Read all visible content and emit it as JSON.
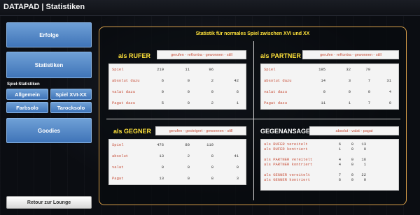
{
  "window": {
    "title": "DATAPAD | Statistiken"
  },
  "nav": {
    "erfolge": "Erfolge",
    "statistiken": "Statistiken",
    "section_label": "Spiel-Statistiken",
    "allgemein": "Allgemein",
    "spiel_xvi_xx": "Spiel XVI-XX",
    "farbsolo": "Farbsolo",
    "tarocksolo": "Tarocksolo",
    "goodies": "Goodies",
    "retour": "Retour zur Lounge"
  },
  "panel": {
    "title": "Statistik für normales Spiel zwischen XVI und XX",
    "rufer": {
      "heading": "als RUFER",
      "columns": "gerufen - reKontra - gewonnen - still",
      "rows": [
        {
          "label": "Spiel",
          "values": [
            "219",
            "11",
            "96",
            ""
          ]
        },
        {
          "label": "absolut dazu",
          "values": [
            "6",
            "0",
            "2",
            "42"
          ]
        },
        {
          "label": "valat dazu",
          "values": [
            "0",
            "0",
            "0",
            "6"
          ]
        },
        {
          "label": "Pagat dazu",
          "values": [
            "5",
            "0",
            "2",
            "1"
          ]
        }
      ]
    },
    "partner": {
      "heading": "als PARTNER",
      "columns": "gerufen - reKontra - gewonnen - still",
      "rows": [
        {
          "label": "Spiel",
          "values": [
            "195",
            "32",
            "79",
            ""
          ]
        },
        {
          "label": "absolut dazu",
          "values": [
            "14",
            "3",
            "7",
            "31"
          ]
        },
        {
          "label": "valat dazu",
          "values": [
            "0",
            "0",
            "0",
            "4"
          ]
        },
        {
          "label": "Pagat dazu",
          "values": [
            "11",
            "1",
            "7",
            "0"
          ]
        }
      ]
    },
    "gegner": {
      "heading": "als GEGNER",
      "columns": "gerufen - gesteigert - gewonnen - still",
      "rows": [
        {
          "label": "Spiel",
          "values": [
            "476",
            "80",
            "119",
            ""
          ]
        },
        {
          "label": "absolut",
          "values": [
            "13",
            "2",
            "8",
            "41"
          ]
        },
        {
          "label": "valat",
          "values": [
            "0",
            "0",
            "0",
            "0"
          ]
        },
        {
          "label": "Pagat",
          "values": [
            "13",
            "0",
            "8",
            "3"
          ]
        }
      ]
    },
    "ansagen": {
      "heading": "GEGENANSAGEN",
      "columns": "absolut - valat - pagat",
      "groups": [
        {
          "lines": [
            "als RUFER vereitelt",
            "als RUFER kontriert"
          ],
          "values": [
            [
              "6",
              "0",
              "13"
            ],
            [
              "1",
              "0",
              "0"
            ]
          ]
        },
        {
          "lines": [
            "als PARTNER vereitelt",
            "als PARTNER kontriert"
          ],
          "values": [
            [
              "4",
              "0",
              "16"
            ],
            [
              "4",
              "0",
              "1"
            ]
          ]
        },
        {
          "lines": [
            "als GEGNER vereitelt",
            "als GEGNER kontriert"
          ],
          "values": [
            [
              "7",
              "0",
              "22"
            ],
            [
              "6",
              "0",
              "0"
            ]
          ]
        }
      ]
    }
  }
}
